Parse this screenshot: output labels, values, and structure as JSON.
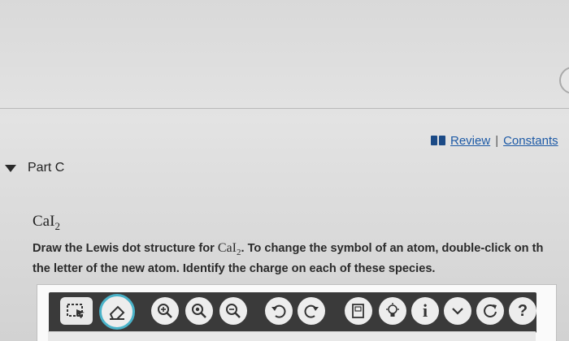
{
  "header": {
    "review_label": "Review",
    "separator": "|",
    "constants_label": "Constants"
  },
  "part": {
    "label": "Part C"
  },
  "formula": {
    "main": "CaI",
    "subscript": "2"
  },
  "question": {
    "line1_prefix": "Draw the Lewis dot structure for ",
    "chem_main": "CaI",
    "chem_sub": "2",
    "line1_suffix": ". To change the symbol of an atom, double-click on th",
    "line2": "the letter of the new atom. Identify the charge on each of these species."
  },
  "toolbar": {
    "tools": [
      "select-tool-icon",
      "eraser-tool-icon",
      "zoom-in-icon",
      "zoom-reset-icon",
      "zoom-out-icon",
      "undo-icon",
      "redo-icon",
      "templates-icon",
      "hint-icon",
      "info-icon",
      "more-icon",
      "reset-icon",
      "help-icon"
    ],
    "info_glyph": "i",
    "help_glyph": "?"
  },
  "colors": {
    "link": "#1d5aa6",
    "toolbar_bg": "#3a3a3a",
    "eraser_ring": "#4ab3c9"
  }
}
